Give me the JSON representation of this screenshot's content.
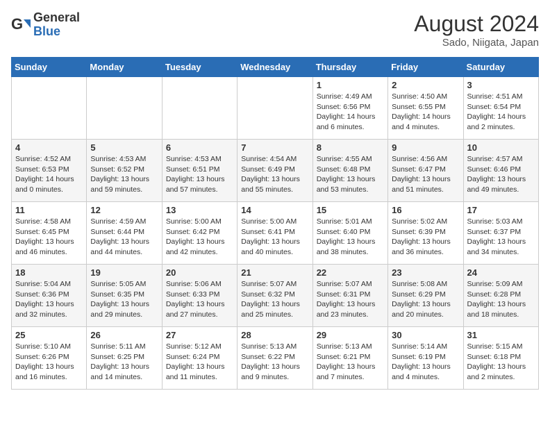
{
  "header": {
    "logo_line1": "General",
    "logo_line2": "Blue",
    "month_year": "August 2024",
    "location": "Sado, Niigata, Japan"
  },
  "weekdays": [
    "Sunday",
    "Monday",
    "Tuesday",
    "Wednesday",
    "Thursday",
    "Friday",
    "Saturday"
  ],
  "weeks": [
    [
      {
        "day": "",
        "text": ""
      },
      {
        "day": "",
        "text": ""
      },
      {
        "day": "",
        "text": ""
      },
      {
        "day": "",
        "text": ""
      },
      {
        "day": "1",
        "text": "Sunrise: 4:49 AM\nSunset: 6:56 PM\nDaylight: 14 hours\nand 6 minutes."
      },
      {
        "day": "2",
        "text": "Sunrise: 4:50 AM\nSunset: 6:55 PM\nDaylight: 14 hours\nand 4 minutes."
      },
      {
        "day": "3",
        "text": "Sunrise: 4:51 AM\nSunset: 6:54 PM\nDaylight: 14 hours\nand 2 minutes."
      }
    ],
    [
      {
        "day": "4",
        "text": "Sunrise: 4:52 AM\nSunset: 6:53 PM\nDaylight: 14 hours\nand 0 minutes."
      },
      {
        "day": "5",
        "text": "Sunrise: 4:53 AM\nSunset: 6:52 PM\nDaylight: 13 hours\nand 59 minutes."
      },
      {
        "day": "6",
        "text": "Sunrise: 4:53 AM\nSunset: 6:51 PM\nDaylight: 13 hours\nand 57 minutes."
      },
      {
        "day": "7",
        "text": "Sunrise: 4:54 AM\nSunset: 6:49 PM\nDaylight: 13 hours\nand 55 minutes."
      },
      {
        "day": "8",
        "text": "Sunrise: 4:55 AM\nSunset: 6:48 PM\nDaylight: 13 hours\nand 53 minutes."
      },
      {
        "day": "9",
        "text": "Sunrise: 4:56 AM\nSunset: 6:47 PM\nDaylight: 13 hours\nand 51 minutes."
      },
      {
        "day": "10",
        "text": "Sunrise: 4:57 AM\nSunset: 6:46 PM\nDaylight: 13 hours\nand 49 minutes."
      }
    ],
    [
      {
        "day": "11",
        "text": "Sunrise: 4:58 AM\nSunset: 6:45 PM\nDaylight: 13 hours\nand 46 minutes."
      },
      {
        "day": "12",
        "text": "Sunrise: 4:59 AM\nSunset: 6:44 PM\nDaylight: 13 hours\nand 44 minutes."
      },
      {
        "day": "13",
        "text": "Sunrise: 5:00 AM\nSunset: 6:42 PM\nDaylight: 13 hours\nand 42 minutes."
      },
      {
        "day": "14",
        "text": "Sunrise: 5:00 AM\nSunset: 6:41 PM\nDaylight: 13 hours\nand 40 minutes."
      },
      {
        "day": "15",
        "text": "Sunrise: 5:01 AM\nSunset: 6:40 PM\nDaylight: 13 hours\nand 38 minutes."
      },
      {
        "day": "16",
        "text": "Sunrise: 5:02 AM\nSunset: 6:39 PM\nDaylight: 13 hours\nand 36 minutes."
      },
      {
        "day": "17",
        "text": "Sunrise: 5:03 AM\nSunset: 6:37 PM\nDaylight: 13 hours\nand 34 minutes."
      }
    ],
    [
      {
        "day": "18",
        "text": "Sunrise: 5:04 AM\nSunset: 6:36 PM\nDaylight: 13 hours\nand 32 minutes."
      },
      {
        "day": "19",
        "text": "Sunrise: 5:05 AM\nSunset: 6:35 PM\nDaylight: 13 hours\nand 29 minutes."
      },
      {
        "day": "20",
        "text": "Sunrise: 5:06 AM\nSunset: 6:33 PM\nDaylight: 13 hours\nand 27 minutes."
      },
      {
        "day": "21",
        "text": "Sunrise: 5:07 AM\nSunset: 6:32 PM\nDaylight: 13 hours\nand 25 minutes."
      },
      {
        "day": "22",
        "text": "Sunrise: 5:07 AM\nSunset: 6:31 PM\nDaylight: 13 hours\nand 23 minutes."
      },
      {
        "day": "23",
        "text": "Sunrise: 5:08 AM\nSunset: 6:29 PM\nDaylight: 13 hours\nand 20 minutes."
      },
      {
        "day": "24",
        "text": "Sunrise: 5:09 AM\nSunset: 6:28 PM\nDaylight: 13 hours\nand 18 minutes."
      }
    ],
    [
      {
        "day": "25",
        "text": "Sunrise: 5:10 AM\nSunset: 6:26 PM\nDaylight: 13 hours\nand 16 minutes."
      },
      {
        "day": "26",
        "text": "Sunrise: 5:11 AM\nSunset: 6:25 PM\nDaylight: 13 hours\nand 14 minutes."
      },
      {
        "day": "27",
        "text": "Sunrise: 5:12 AM\nSunset: 6:24 PM\nDaylight: 13 hours\nand 11 minutes."
      },
      {
        "day": "28",
        "text": "Sunrise: 5:13 AM\nSunset: 6:22 PM\nDaylight: 13 hours\nand 9 minutes."
      },
      {
        "day": "29",
        "text": "Sunrise: 5:13 AM\nSunset: 6:21 PM\nDaylight: 13 hours\nand 7 minutes."
      },
      {
        "day": "30",
        "text": "Sunrise: 5:14 AM\nSunset: 6:19 PM\nDaylight: 13 hours\nand 4 minutes."
      },
      {
        "day": "31",
        "text": "Sunrise: 5:15 AM\nSunset: 6:18 PM\nDaylight: 13 hours\nand 2 minutes."
      }
    ]
  ]
}
